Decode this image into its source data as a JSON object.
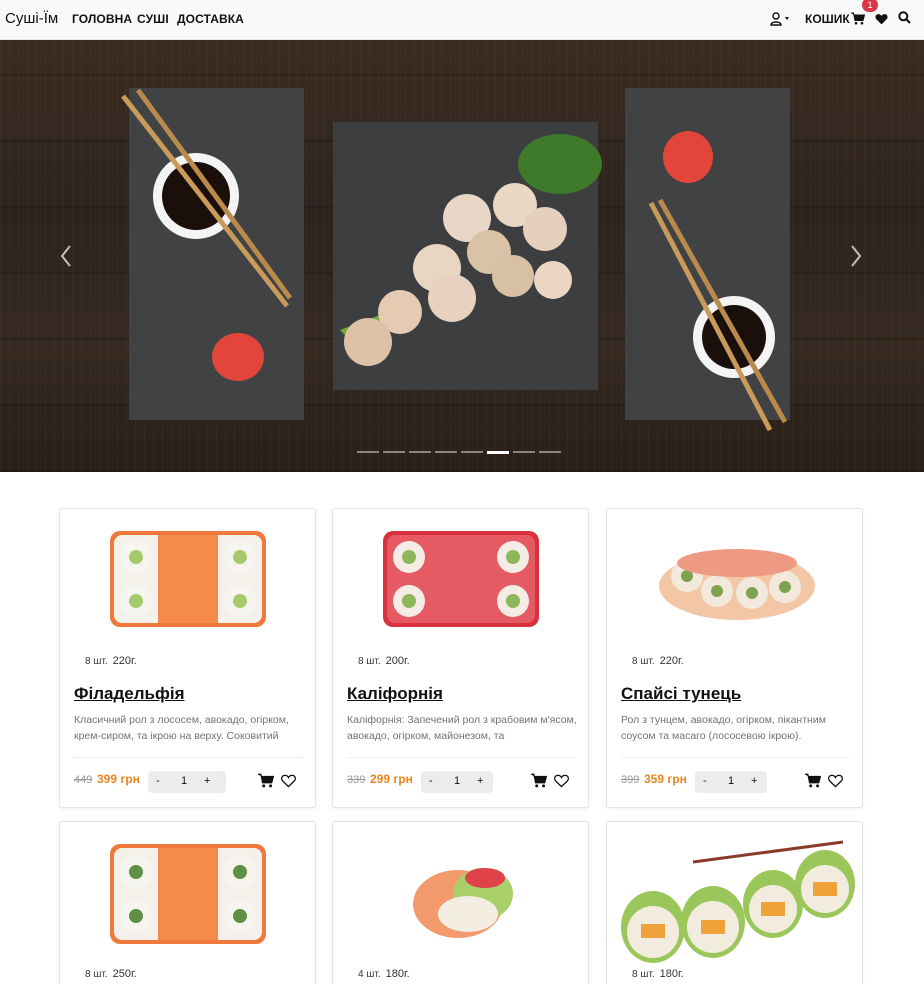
{
  "navbar": {
    "brand": "Суші-Їм",
    "links": [
      "ГОЛОВНА",
      "СУШІ",
      "ДОСТАВКА"
    ],
    "cart_label": "КОШИК",
    "cart_count": "1"
  },
  "carousel": {
    "indicator_count": 8,
    "active_index": 5
  },
  "products": [
    {
      "qty": "8 шт.",
      "weight": "220г.",
      "name": "Філадельфія",
      "desc": "Класичний рол з лососем, авокадо, огірком, крем-сиром, та ікрою на верху. Соковитий",
      "old_price": "449",
      "price": "399 грн",
      "count": "1"
    },
    {
      "qty": "8 шт.",
      "weight": "200г.",
      "name": "Каліфорнія",
      "desc": "Каліфорнія: Запечений рол з крабовим м'ясом, авокадо, огірком, майонезом, та",
      "old_price": "339",
      "price": "299 грн",
      "count": "1"
    },
    {
      "qty": "8 шт.",
      "weight": "220г.",
      "name": "Спайсі тунець",
      "desc": "Рол з тунцем, авокадо, огірком, пікантним соусом та масаго (лососевою ікрою).",
      "old_price": "399",
      "price": "359 грн",
      "count": "1"
    },
    {
      "qty": "8 шт.",
      "weight": "250г."
    },
    {
      "qty": "4 шт.",
      "weight": "180г."
    },
    {
      "qty": "8 шт.",
      "weight": "180г."
    }
  ],
  "stepper": {
    "minus": "-",
    "plus": "+"
  },
  "colors": {
    "accent_price": "#e8861f",
    "badge": "#dc3545",
    "navbar_bg": "#f8f9fa"
  }
}
